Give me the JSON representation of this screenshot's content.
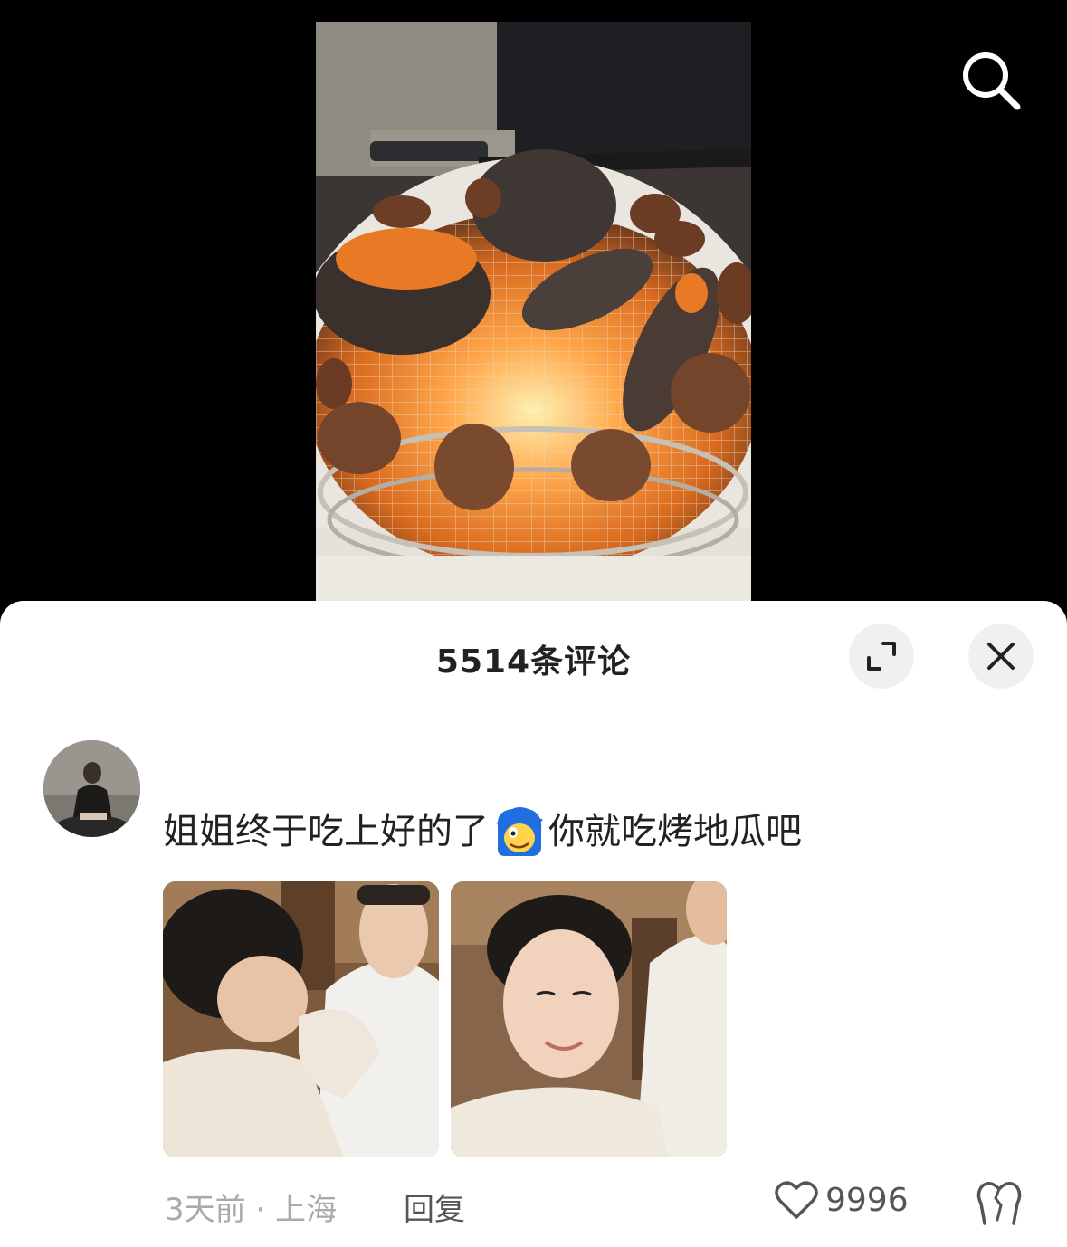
{
  "search": {
    "icon": "search-icon"
  },
  "comments_panel": {
    "title": "5514条评论",
    "expand_icon": "expand-icon",
    "close_icon": "close-icon"
  },
  "comment": {
    "text_before": "姐姐终于吃上好的了",
    "emoji": "funny-face-emoji",
    "text_after": "你就吃烤地瓜吧",
    "time": "3天前",
    "separator": "·",
    "location": "上海",
    "reply_label": "回复",
    "like_count": "9996"
  },
  "colors": {
    "sheet_bg": "#ffffff",
    "video_bg": "#000000"
  }
}
